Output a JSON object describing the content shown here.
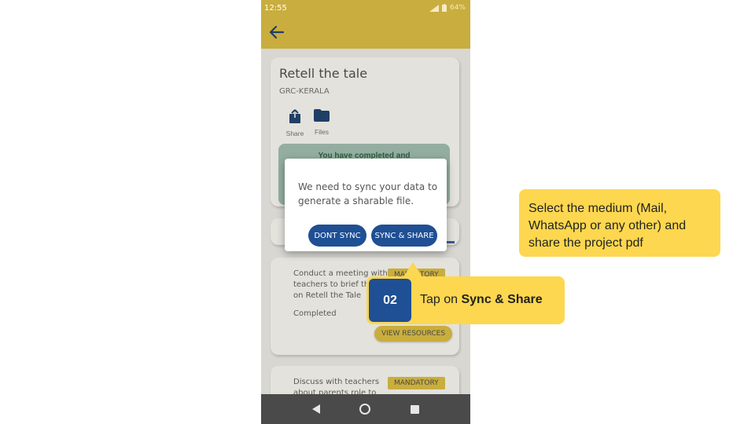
{
  "status_bar": {
    "time": "12:55",
    "battery": "64%"
  },
  "app": {
    "back_icon": "arrow-left-icon",
    "accent_color": "#c9ad3e",
    "primary_blue": "#1f4f94"
  },
  "project_card": {
    "title": "Retell the tale",
    "subtitle": "GRC-KERALA",
    "actions": [
      {
        "label": "Share",
        "icon": "share-icon"
      },
      {
        "label": "Files",
        "icon": "folder-icon"
      }
    ],
    "completion_banner": "You have completed and"
  },
  "tasks": [
    {
      "text": "Conduct a meeting with teachers to brief them on Retell the Tale",
      "badge": "MANDATORY",
      "status": "Completed",
      "action_label": "VIEW RESOURCES"
    },
    {
      "text": "Discuss with teachers about parents role to",
      "badge": "MANDATORY"
    }
  ],
  "dialog": {
    "message": "We need to sync your data to generate a sharable file.",
    "dont_sync_label": "DONT SYNC",
    "sync_share_label": "SYNC & SHARE"
  },
  "callouts": {
    "medium_note": "Select the medium (Mail, WhatsApp or any other) and share the project pdf",
    "step_number": "02",
    "step_prefix": "Tap on ",
    "step_bold": "Sync & Share",
    "callout_color": "#fdd74f"
  },
  "nav_bar": {
    "icons": [
      "back-triangle-icon",
      "home-circle-icon",
      "recents-square-icon"
    ]
  }
}
